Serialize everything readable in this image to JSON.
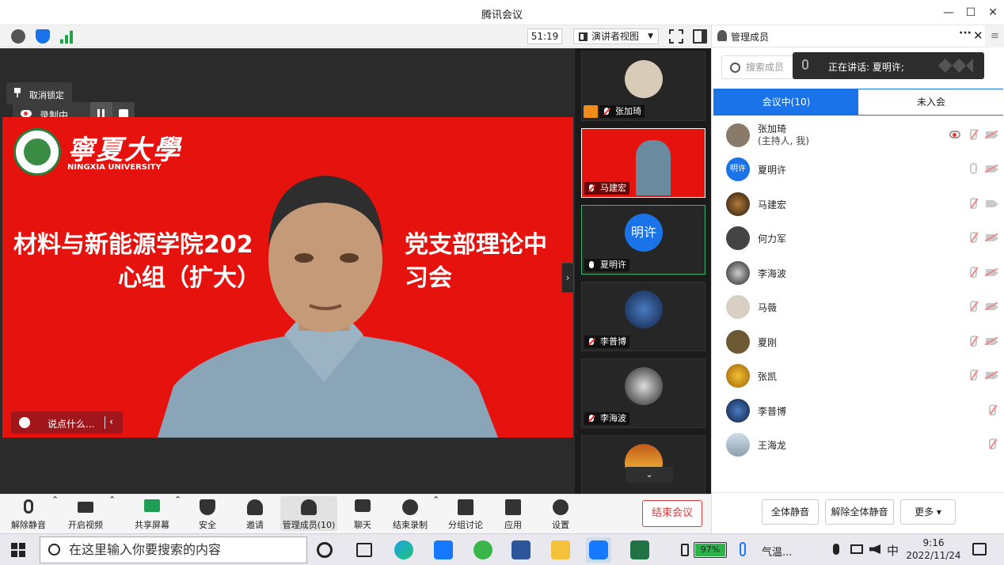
{
  "window": {
    "title": "腾讯会议",
    "minimize": "—",
    "maximize": "☐",
    "close": "✕"
  },
  "toolbar": {
    "timer": "51:19",
    "view_mode": "演讲者视图",
    "dropdown": "▼"
  },
  "stage": {
    "recording_label": "录制中",
    "unpin_label": "取消锁定",
    "chat_placeholder": "说点什么...",
    "chat_toggle": "‹",
    "next_page": "›",
    "slide": {
      "univ_cn": "寧夏大學",
      "univ_en": "NINGXIA UNIVERSITY",
      "line1_left": "材料与新能源学院202",
      "line1_right": "党支部理论中",
      "line2_left": "心组（扩大）",
      "line2_right": "习会"
    }
  },
  "thumbs": [
    {
      "name": "张加琦",
      "muted": true
    },
    {
      "name": "马建宏",
      "muted": true
    },
    {
      "name": "夏明许",
      "muted": false,
      "avatar_text": "明许"
    },
    {
      "name": "李普博",
      "muted": true
    },
    {
      "name": "李海波",
      "muted": true
    }
  ],
  "thumbs_scroll": "⌄",
  "panel": {
    "title": "管理成员",
    "more": "···",
    "close": "✕",
    "menu": "≡",
    "search_placeholder": "搜索成员",
    "speaking": "正在讲话: 夏明许;",
    "tab_in": "会议中(10)",
    "tab_out": "未入会",
    "members": [
      {
        "name": "张加琦",
        "sub": "(主持人, 我)",
        "recording": true,
        "mic": "muted",
        "cam": "muted",
        "avatar": "#8a7a6a"
      },
      {
        "name": "夏明许",
        "avatar_text": "明许",
        "mic": "on",
        "cam": "muted",
        "avatar": "#1a73e8"
      },
      {
        "name": "马建宏",
        "mic": "muted",
        "cam": "off",
        "avatar": "#3b2a1a"
      },
      {
        "name": "何力军",
        "mic": "muted",
        "cam": "muted",
        "avatar": "#444"
      },
      {
        "name": "李海波",
        "mic": "muted",
        "cam": "muted",
        "avatar": "#333"
      },
      {
        "name": "马薇",
        "mic": "muted",
        "cam": "muted",
        "avatar": "#c9bfb5"
      },
      {
        "name": "夏刚",
        "mic": "muted",
        "cam": "muted",
        "avatar": "#6d5a35"
      },
      {
        "name": "张凯",
        "mic": "muted",
        "cam": "muted",
        "avatar": "#c88a20"
      },
      {
        "name": "李普博",
        "mic": "muted",
        "avatar": "#1c3b6e"
      },
      {
        "name": "王海龙",
        "mic": "muted",
        "avatar": "#8aa0b0"
      }
    ],
    "mute_all": "全体静音",
    "unmute_all": "解除全体静音",
    "more_btn": "更多 ▾"
  },
  "controls": {
    "unmute": "解除静音",
    "video": "开启视频",
    "share": "共享屏幕",
    "security": "安全",
    "invite": "邀请",
    "members": "管理成员(10)",
    "chat": "聊天",
    "end_record": "结束录制",
    "breakout": "分组讨论",
    "apps": "应用",
    "settings": "设置",
    "end_meeting": "结束会议",
    "caret": "⌃"
  },
  "taskbar": {
    "search_placeholder": "在这里输入你要搜索的内容",
    "battery": "97%",
    "weather": "气温...",
    "ime": "中",
    "time": "9:16",
    "date": "2022/11/24"
  },
  "colors": {
    "accent": "#1a73e8",
    "slide_red": "#e5120e",
    "end_red": "#e03a3a"
  }
}
